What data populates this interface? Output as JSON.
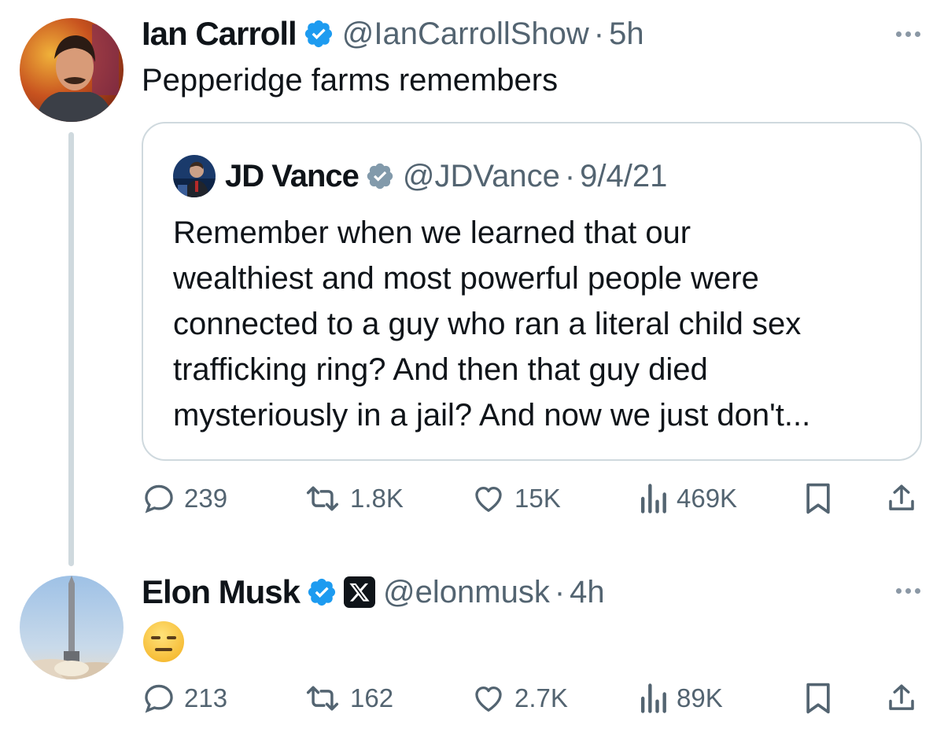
{
  "tweet1": {
    "author_name": "Ian Carroll",
    "handle": "@IanCarrollShow",
    "separator": "·",
    "time": "5h",
    "text": "Pepperidge farms remembers",
    "icons": {
      "verified": "verified-badge-icon",
      "more": "more-options-icon"
    },
    "quote": {
      "author_name": "JD Vance",
      "handle": "@JDVance",
      "separator": "·",
      "date": "9/4/21",
      "text_lines": [
        "Remember when we learned that our",
        "wealthiest and most powerful people were",
        "connected to a guy who ran a literal child sex",
        "trafficking ring? And then that guy died",
        "mysteriously in a jail? And now we just don't..."
      ]
    },
    "actions": {
      "replies": "239",
      "reposts": "1.8K",
      "likes": "15K",
      "views": "469K"
    }
  },
  "tweet2": {
    "author_name": "Elon Musk",
    "handle": "@elonmusk",
    "separator": "·",
    "time": "4h",
    "emoji_name": "expressionless-face-emoji",
    "actions": {
      "replies": "213",
      "reposts": "162",
      "likes": "2.7K",
      "views": "89K"
    }
  },
  "colors": {
    "text_primary": "#0f1419",
    "text_secondary": "#536471",
    "verified_blue": "#1d9bf0",
    "border": "#cfd9de"
  }
}
